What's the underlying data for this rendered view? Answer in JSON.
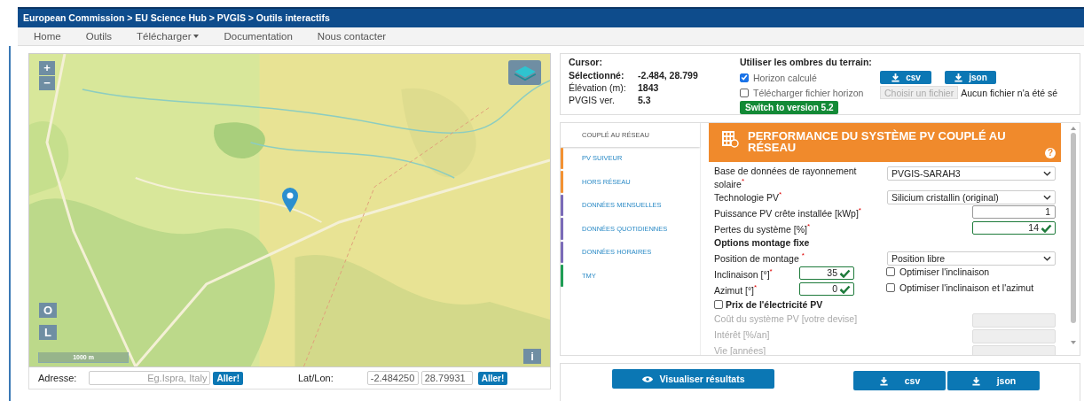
{
  "breadcrumb": "European Commission > EU Science Hub > PVGIS > Outils interactifs",
  "nav": [
    {
      "label": "Home",
      "has_menu": false
    },
    {
      "label": "Outils",
      "has_menu": false
    },
    {
      "label": "Télécharger",
      "has_menu": true
    },
    {
      "label": "Documentation",
      "has_menu": false
    },
    {
      "label": "Nous contacter",
      "has_menu": false
    }
  ],
  "map": {
    "zoom_in": "+",
    "zoom_out": "−",
    "locate": "O",
    "layer_toggle": "L",
    "scale": "1000 m",
    "info": "i"
  },
  "address": {
    "label": "Adresse:",
    "placeholder": "Eg.Ispra, Italy",
    "button": "Aller!"
  },
  "latlon": {
    "label": "Lat/Lon:",
    "lat": "-2.484250",
    "lon": "28.79931",
    "button": "Aller!"
  },
  "cursor": {
    "title": "Cursor:",
    "rows": [
      {
        "label": "Sélectionné:",
        "value": "-2.484, 28.799",
        "bold": true
      },
      {
        "label": "Élévation (m):",
        "value": "1843",
        "bold": false
      },
      {
        "label": "PVGIS ver.",
        "value": "5.3",
        "bold": false
      }
    ]
  },
  "terrain": {
    "title": "Utiliser les ombres du terrain:",
    "horizon": {
      "label": "Horizon calculé",
      "checked": true
    },
    "csv": "csv",
    "json": "json",
    "upload": {
      "label": "Télécharger fichier horizon",
      "checked": false
    },
    "file_button": "Choisir un fichier",
    "file_status": "Aucun fichier n'a été sé",
    "switch": "Switch to version 5.2"
  },
  "tabs": [
    {
      "label": "COUPLÉ AU RÉSEAU",
      "selected": true
    },
    {
      "label": "PV SUIVEUR",
      "selected": false,
      "color": "#f39233"
    },
    {
      "label": "HORS RÉSEAU",
      "selected": false,
      "color": "#f39233"
    },
    {
      "label": "DONNÉES MENSUELLES",
      "selected": false,
      "color": "#7b6bb8"
    },
    {
      "label": "DONNÉES QUOTIDIENNES",
      "selected": false,
      "color": "#7b6bb8"
    },
    {
      "label": "DONNÉES HORAIRES",
      "selected": false,
      "color": "#7b6bb8"
    },
    {
      "label": "TMY",
      "selected": false,
      "color": "#1f9d55"
    }
  ],
  "form": {
    "title": "PERFORMANCE DU SYSTÈME PV COUPLÉ AU RÉSEAU",
    "help": "?",
    "rows": [
      {
        "kind": "select",
        "label": "Base de données de rayonnement solaire$^{*}$",
        "value": "PVGIS-SARAH3"
      },
      {
        "kind": "select",
        "label": "Technologie PV$^{*}$",
        "value": "Silicium cristallin (original)"
      },
      {
        "kind": "number",
        "label": "Puissance PV crête installée [kWp]$^{*}$",
        "value": "1",
        "valid": false
      },
      {
        "kind": "number",
        "label": "Pertes du système [%]$^{*}$",
        "value": "14",
        "valid": true
      },
      {
        "kind": "heading",
        "label": "Options montage fixe"
      },
      {
        "kind": "select",
        "label": "Position de montage $^{*}$",
        "value": "Position libre"
      },
      {
        "kind": "angle",
        "label": "Inclinaison [°]$^{*}$",
        "value": "35",
        "valid": true,
        "option": {
          "label": "Optimiser l'inclinaison",
          "checked": false
        }
      },
      {
        "kind": "angle",
        "label": "Azimut [°]$^{*}$",
        "value": "0",
        "valid": true,
        "option": {
          "label": "Optimiser l'inclinaison et l'azimut",
          "checked": false
        }
      },
      {
        "kind": "checkbox",
        "label": "Prix de l'électricité PV",
        "checked": false
      },
      {
        "kind": "disabled",
        "label": "Coût du système PV [votre devise]"
      },
      {
        "kind": "disabled",
        "label": "Intérêt [%/an]"
      },
      {
        "kind": "disabled",
        "label": "Vie [années]"
      }
    ]
  },
  "actions": {
    "view": "Visualiser résultats",
    "csv": "csv",
    "json": "json"
  }
}
